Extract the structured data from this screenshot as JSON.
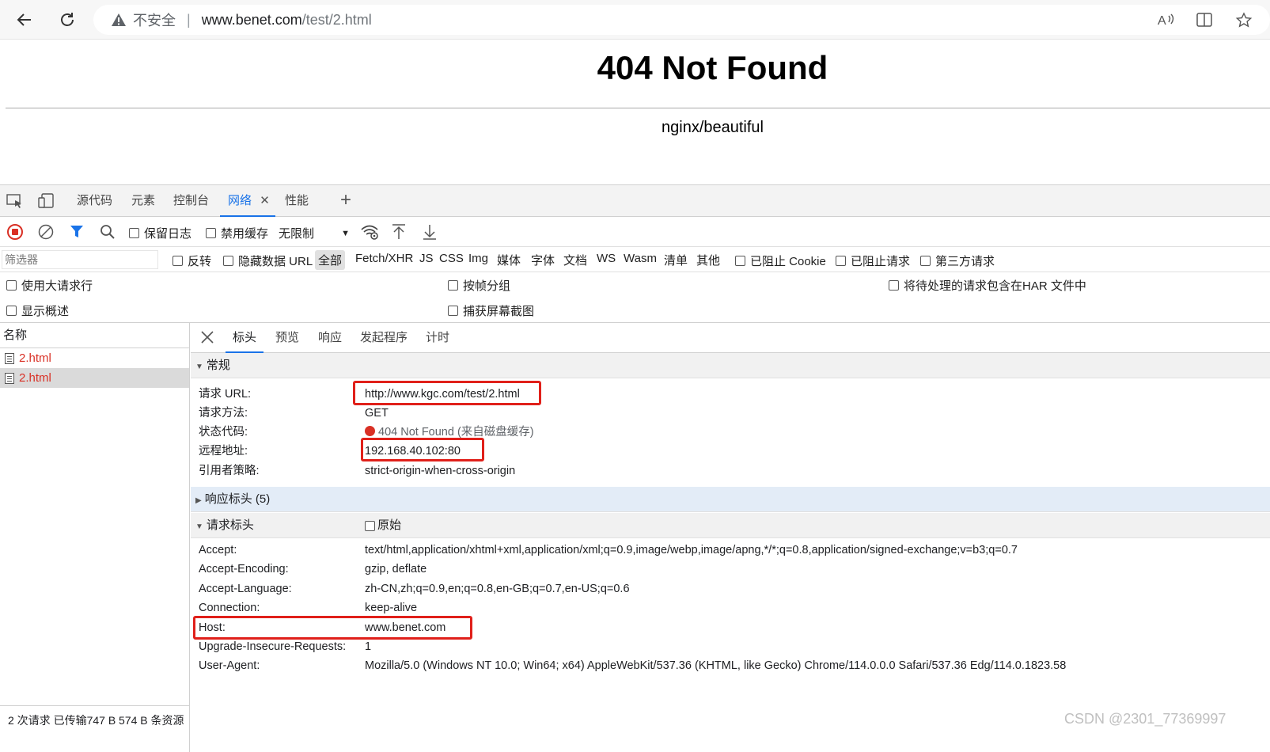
{
  "browser": {
    "insecure_label": "不安全",
    "url_host": "www.benet.com",
    "url_path": "/test/2.html"
  },
  "page": {
    "heading": "404 Not Found",
    "server": "nginx/beautiful"
  },
  "devtools": {
    "tabs": [
      "源代码",
      "元素",
      "控制台",
      "网络",
      "性能"
    ],
    "toolbar": {
      "preserve_log": "保留日志",
      "disable_cache": "禁用缓存",
      "throttling": "无限制"
    },
    "filter": {
      "placeholder": "筛选器",
      "invert": "反转",
      "hide_data_urls": "隐藏数据 URL",
      "types": [
        "全部",
        "Fetch/XHR",
        "JS",
        "CSS",
        "Img",
        "媒体",
        "字体",
        "文档",
        "WS",
        "Wasm",
        "清单",
        "其他"
      ],
      "blocked_cookies": "已阻止 Cookie",
      "blocked_requests": "已阻止请求",
      "third_party": "第三方请求"
    },
    "options": {
      "big_rows": "使用大请求行",
      "group_by_frame": "按帧分组",
      "include_pending_har": "将待处理的请求包含在HAR 文件中",
      "show_overview": "显示概述",
      "capture_screenshots": "捕获屏幕截图"
    },
    "request_list": {
      "header": "名称",
      "items": [
        "2.html",
        "2.html"
      ],
      "status": "2 次请求  已传输747 B  574 B 条资源"
    },
    "detail": {
      "tabs": [
        "标头",
        "预览",
        "响应",
        "发起程序",
        "计时"
      ],
      "general": {
        "title": "常规",
        "rows": [
          {
            "k": "请求 URL:",
            "v": "http://www.kgc.com/test/2.html"
          },
          {
            "k": "请求方法:",
            "v": "GET"
          },
          {
            "k": "状态代码:",
            "v": "404 Not Found (来自磁盘缓存)"
          },
          {
            "k": "远程地址:",
            "v": "192.168.40.102:80"
          },
          {
            "k": "引用者策略:",
            "v": "strict-origin-when-cross-origin"
          }
        ]
      },
      "response_headers": {
        "title": "响应标头 (5)"
      },
      "request_headers": {
        "title": "请求标头",
        "raw_label": "原始",
        "rows": [
          {
            "k": "Accept:",
            "v": "text/html,application/xhtml+xml,application/xml;q=0.9,image/webp,image/apng,*/*;q=0.8,application/signed-exchange;v=b3;q=0.7"
          },
          {
            "k": "Accept-Encoding:",
            "v": "gzip, deflate"
          },
          {
            "k": "Accept-Language:",
            "v": "zh-CN,zh;q=0.9,en;q=0.8,en-GB;q=0.7,en-US;q=0.6"
          },
          {
            "k": "Connection:",
            "v": "keep-alive"
          },
          {
            "k": "Host:",
            "v": "www.benet.com"
          },
          {
            "k": "Upgrade-Insecure-Requests:",
            "v": "1"
          },
          {
            "k": "User-Agent:",
            "v": "Mozilla/5.0 (Windows NT 10.0; Win64; x64) AppleWebKit/537.36 (KHTML, like Gecko) Chrome/114.0.0.0 Safari/537.36 Edg/114.0.1823.58"
          }
        ]
      }
    }
  },
  "watermark": "CSDN @2301_77369997",
  "colors": {
    "accent": "#1a73e8",
    "error": "#d93025",
    "highlight_box": "#e0201a"
  }
}
